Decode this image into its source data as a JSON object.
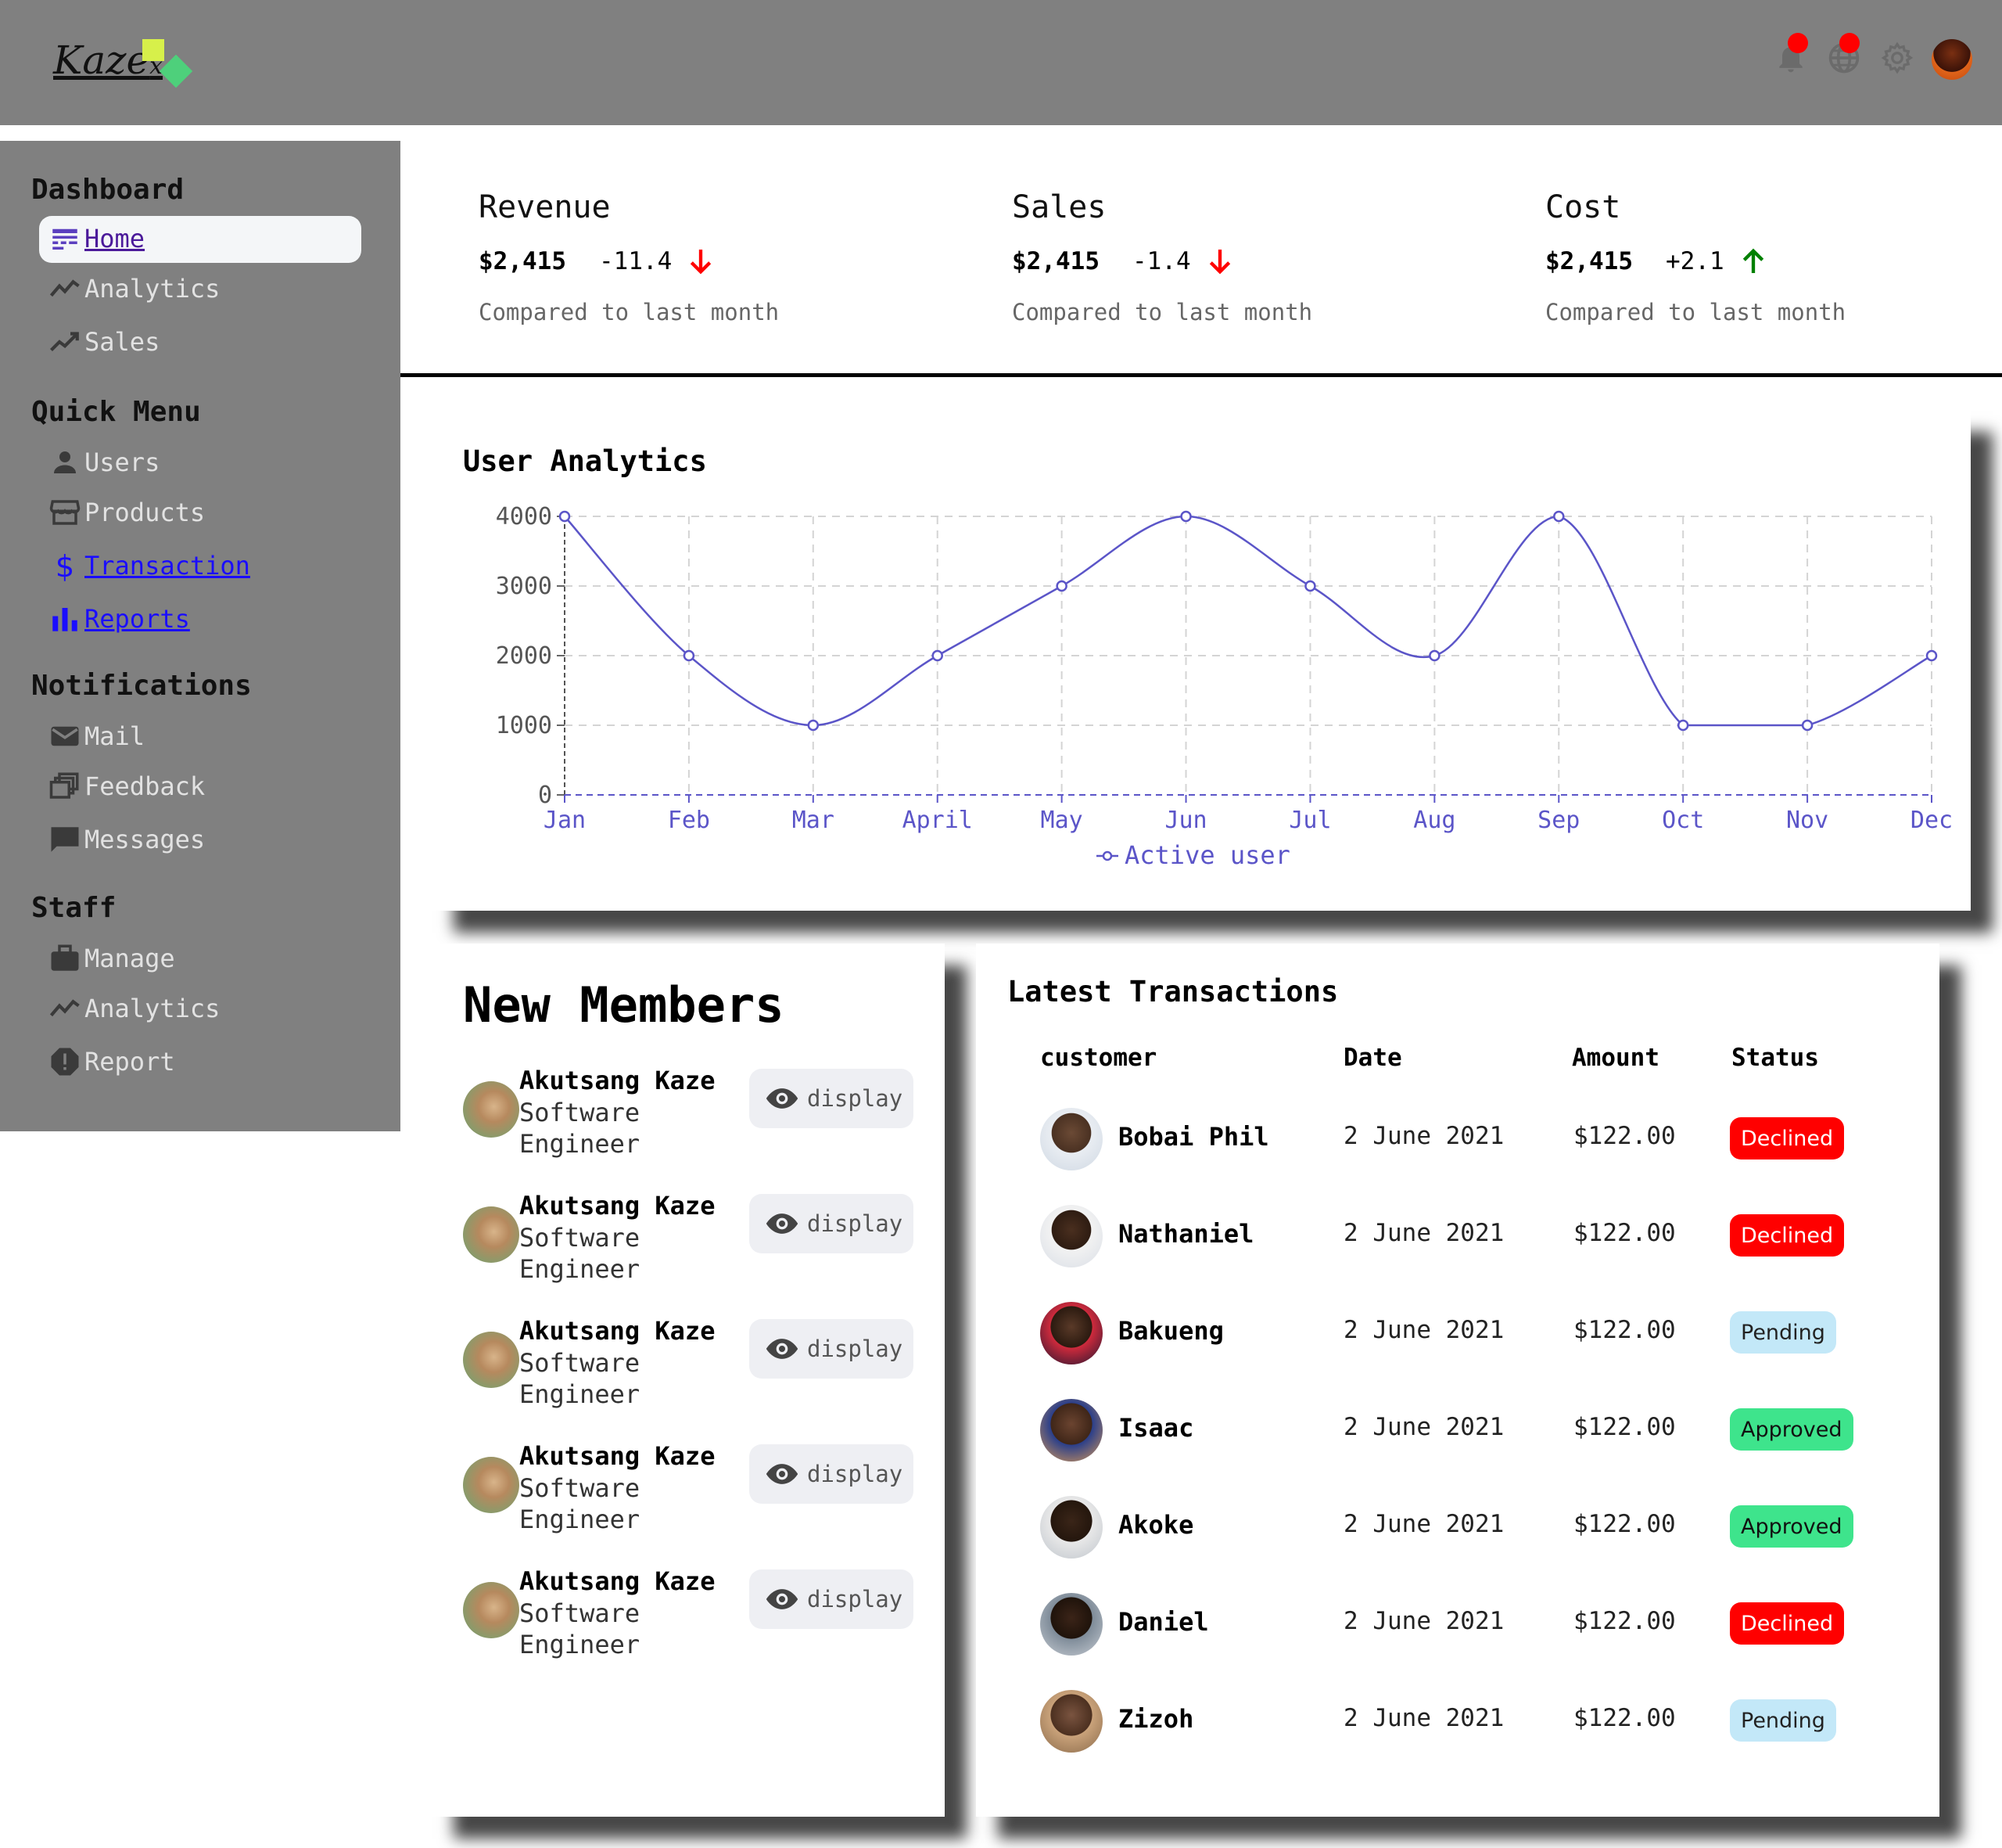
{
  "header": {
    "logo_text": "Kaze",
    "logo_suffix": "x",
    "icons": [
      "bell-icon",
      "globe-icon",
      "gear-icon",
      "avatar"
    ],
    "badge_color": "#ff0000"
  },
  "sidebar": {
    "sections": [
      {
        "title": "Dashboard",
        "items": [
          {
            "label": "Home",
            "icon": "home-icon",
            "active": true
          },
          {
            "label": "Analytics",
            "icon": "trending-icon"
          },
          {
            "label": "Sales",
            "icon": "trending-up-icon"
          }
        ]
      },
      {
        "title": "Quick Menu",
        "items": [
          {
            "label": "Users",
            "icon": "user-icon"
          },
          {
            "label": "Products",
            "icon": "store-icon"
          },
          {
            "label": "Transaction",
            "icon": "dollar-icon",
            "link": true
          },
          {
            "label": "Reports",
            "icon": "bar-chart-icon",
            "link": true
          }
        ]
      },
      {
        "title": "Notifications",
        "items": [
          {
            "label": "Mail",
            "icon": "mail-icon"
          },
          {
            "label": "Feedback",
            "icon": "feedback-icon"
          },
          {
            "label": "Messages",
            "icon": "chat-icon"
          }
        ]
      },
      {
        "title": "Staff",
        "items": [
          {
            "label": "Manage",
            "icon": "briefcase-icon"
          },
          {
            "label": "Analytics",
            "icon": "trending-icon"
          },
          {
            "label": "Report",
            "icon": "alert-icon"
          }
        ]
      }
    ]
  },
  "kpis": [
    {
      "title": "Revenue",
      "value": "$2,415",
      "delta": "-11.4",
      "direction": "down",
      "subtitle": "Compared to last month"
    },
    {
      "title": "Sales",
      "value": "$2,415",
      "delta": "-1.4",
      "direction": "down",
      "subtitle": "Compared to last month"
    },
    {
      "title": "Cost",
      "value": "$2,415",
      "delta": "+2.1",
      "direction": "up",
      "subtitle": "Compared to last month"
    }
  ],
  "colors": {
    "down": "#ff0000",
    "up": "#008000",
    "chart_line": "#5b55c8",
    "declined": "#ff0000",
    "pending": "#c3e8f8",
    "approved": "#3ee48c"
  },
  "chart_data": {
    "type": "line",
    "title": "User Analytics",
    "categories": [
      "Jan",
      "Feb",
      "Mar",
      "April",
      "May",
      "Jun",
      "Jul",
      "Aug",
      "Sep",
      "Oct",
      "Nov",
      "Dec"
    ],
    "series": [
      {
        "name": "Active user",
        "values": [
          4000,
          2000,
          1000,
          2000,
          3000,
          4000,
          3000,
          2000,
          4000,
          1000,
          1000,
          2000
        ]
      }
    ],
    "yticks": [
      0,
      1000,
      2000,
      3000,
      4000
    ],
    "ylim": [
      0,
      4000
    ],
    "grid": true,
    "legend": "bottom-center"
  },
  "members": {
    "title": "New Members",
    "button_label": "display",
    "items": [
      {
        "name": "Akutsang Kaze",
        "role": "Software Engineer"
      },
      {
        "name": "Akutsang Kaze",
        "role": "Software Engineer"
      },
      {
        "name": "Akutsang Kaze",
        "role": "Software Engineer"
      },
      {
        "name": "Akutsang Kaze",
        "role": "Software Engineer"
      },
      {
        "name": "Akutsang Kaze",
        "role": "Software Engineer"
      }
    ]
  },
  "transactions": {
    "title": "Latest Transactions",
    "columns": [
      "customer",
      "Date",
      "Amount",
      "Status"
    ],
    "rows": [
      {
        "customer": "Bobai Phil",
        "date": "2 June 2021",
        "amount": "$122.00",
        "status": "Declined"
      },
      {
        "customer": "Nathaniel",
        "date": "2 June 2021",
        "amount": "$122.00",
        "status": "Declined"
      },
      {
        "customer": "Bakueng",
        "date": "2 June 2021",
        "amount": "$122.00",
        "status": "Pending"
      },
      {
        "customer": "Isaac",
        "date": "2 June 2021",
        "amount": "$122.00",
        "status": "Approved"
      },
      {
        "customer": "Akoke",
        "date": "2 June 2021",
        "amount": "$122.00",
        "status": "Approved"
      },
      {
        "customer": "Daniel",
        "date": "2 June 2021",
        "amount": "$122.00",
        "status": "Declined"
      },
      {
        "customer": "Zizoh",
        "date": "2 June 2021",
        "amount": "$122.00",
        "status": "Pending"
      }
    ]
  }
}
